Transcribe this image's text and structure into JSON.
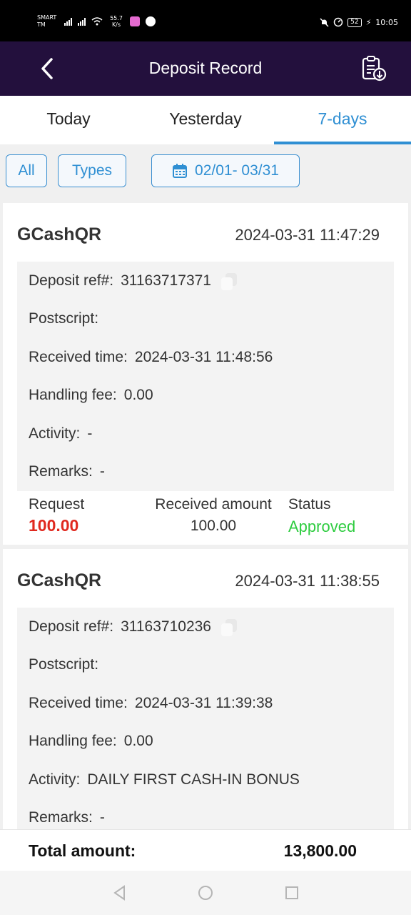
{
  "status_bar": {
    "carrier": "SMART TM",
    "speed": "55.7 K/s",
    "battery": "52",
    "time": "10:05"
  },
  "header": {
    "title": "Deposit Record",
    "back_icon": "chevron-left-icon",
    "export_icon": "clipboard-download-icon"
  },
  "tabs": [
    {
      "label": "Today",
      "active": false
    },
    {
      "label": "Yesterday",
      "active": false
    },
    {
      "label": "7-days",
      "active": true
    }
  ],
  "filters": {
    "all_label": "All",
    "types_label": "Types",
    "date_range": "02/01- 03/31",
    "calendar_icon": "calendar-icon"
  },
  "labels": {
    "deposit_ref": "Deposit ref#:",
    "postscript": "Postscript:",
    "received_time": "Received time:",
    "handling_fee": "Handling fee:",
    "activity": "Activity:",
    "remarks": "Remarks:",
    "request": "Request",
    "received_amount": "Received amount",
    "status": "Status"
  },
  "records": [
    {
      "method": "GCashQR",
      "created_time": "2024-03-31 11:47:29",
      "deposit_ref": "31163717371",
      "postscript": "",
      "received_time": "2024-03-31 11:48:56",
      "handling_fee": "0.00",
      "activity": "-",
      "remarks": "-",
      "request": "100.00",
      "received_amount": "100.00",
      "status": "Approved"
    },
    {
      "method": "GCashQR",
      "created_time": "2024-03-31 11:38:55",
      "deposit_ref": "31163710236",
      "postscript": "",
      "received_time": "2024-03-31 11:39:38",
      "handling_fee": "0.00",
      "activity": "DAILY FIRST CASH-IN BONUS",
      "remarks": "-"
    }
  ],
  "total": {
    "label": "Total amount:",
    "value": "13,800.00"
  },
  "colors": {
    "header_bg": "#23103d",
    "accent": "#2f8fd3",
    "request_red": "#e0291f",
    "approved_green": "#2ecc40"
  }
}
